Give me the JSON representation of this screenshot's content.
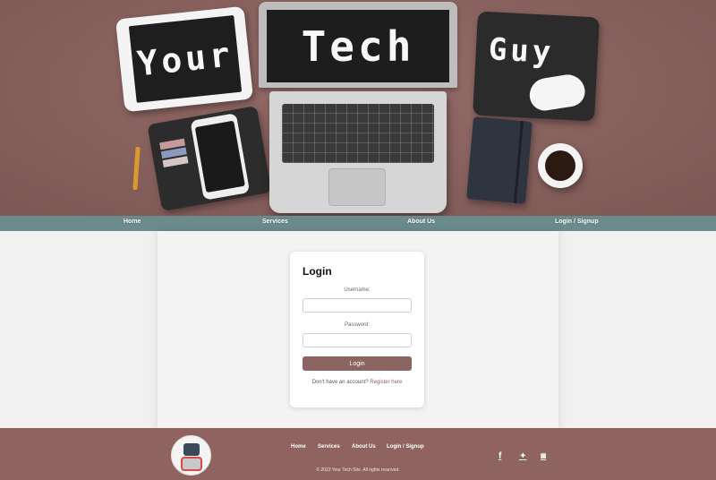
{
  "hero": {
    "word_left": "Your",
    "word_center": "Tech",
    "word_right": "Guy"
  },
  "nav": {
    "items": [
      {
        "label": "Home"
      },
      {
        "label": "Services"
      },
      {
        "label": "About Us"
      },
      {
        "label": "Login / Signup"
      }
    ]
  },
  "login": {
    "title": "Login",
    "username_label": "Username:",
    "username_value": "",
    "password_label": "Password:",
    "password_value": "",
    "submit_label": "Login",
    "register_prompt": "Don't have an account?",
    "register_link": "Register here"
  },
  "footer": {
    "nav": [
      {
        "label": "Home"
      },
      {
        "label": "Services"
      },
      {
        "label": "About Us"
      },
      {
        "label": "Login / Signup"
      }
    ],
    "copyright": "© 2023 Your Tech Site. All rights reserved.",
    "social": [
      {
        "icon": "facebook-icon",
        "glyph": "f"
      },
      {
        "icon": "twitter-icon",
        "glyph": "✦"
      },
      {
        "icon": "instagram-icon",
        "glyph": "◙"
      }
    ]
  },
  "colors": {
    "brand": "#8e6360",
    "nav_bar": "#6b8b8d",
    "button": "#8c6461"
  }
}
